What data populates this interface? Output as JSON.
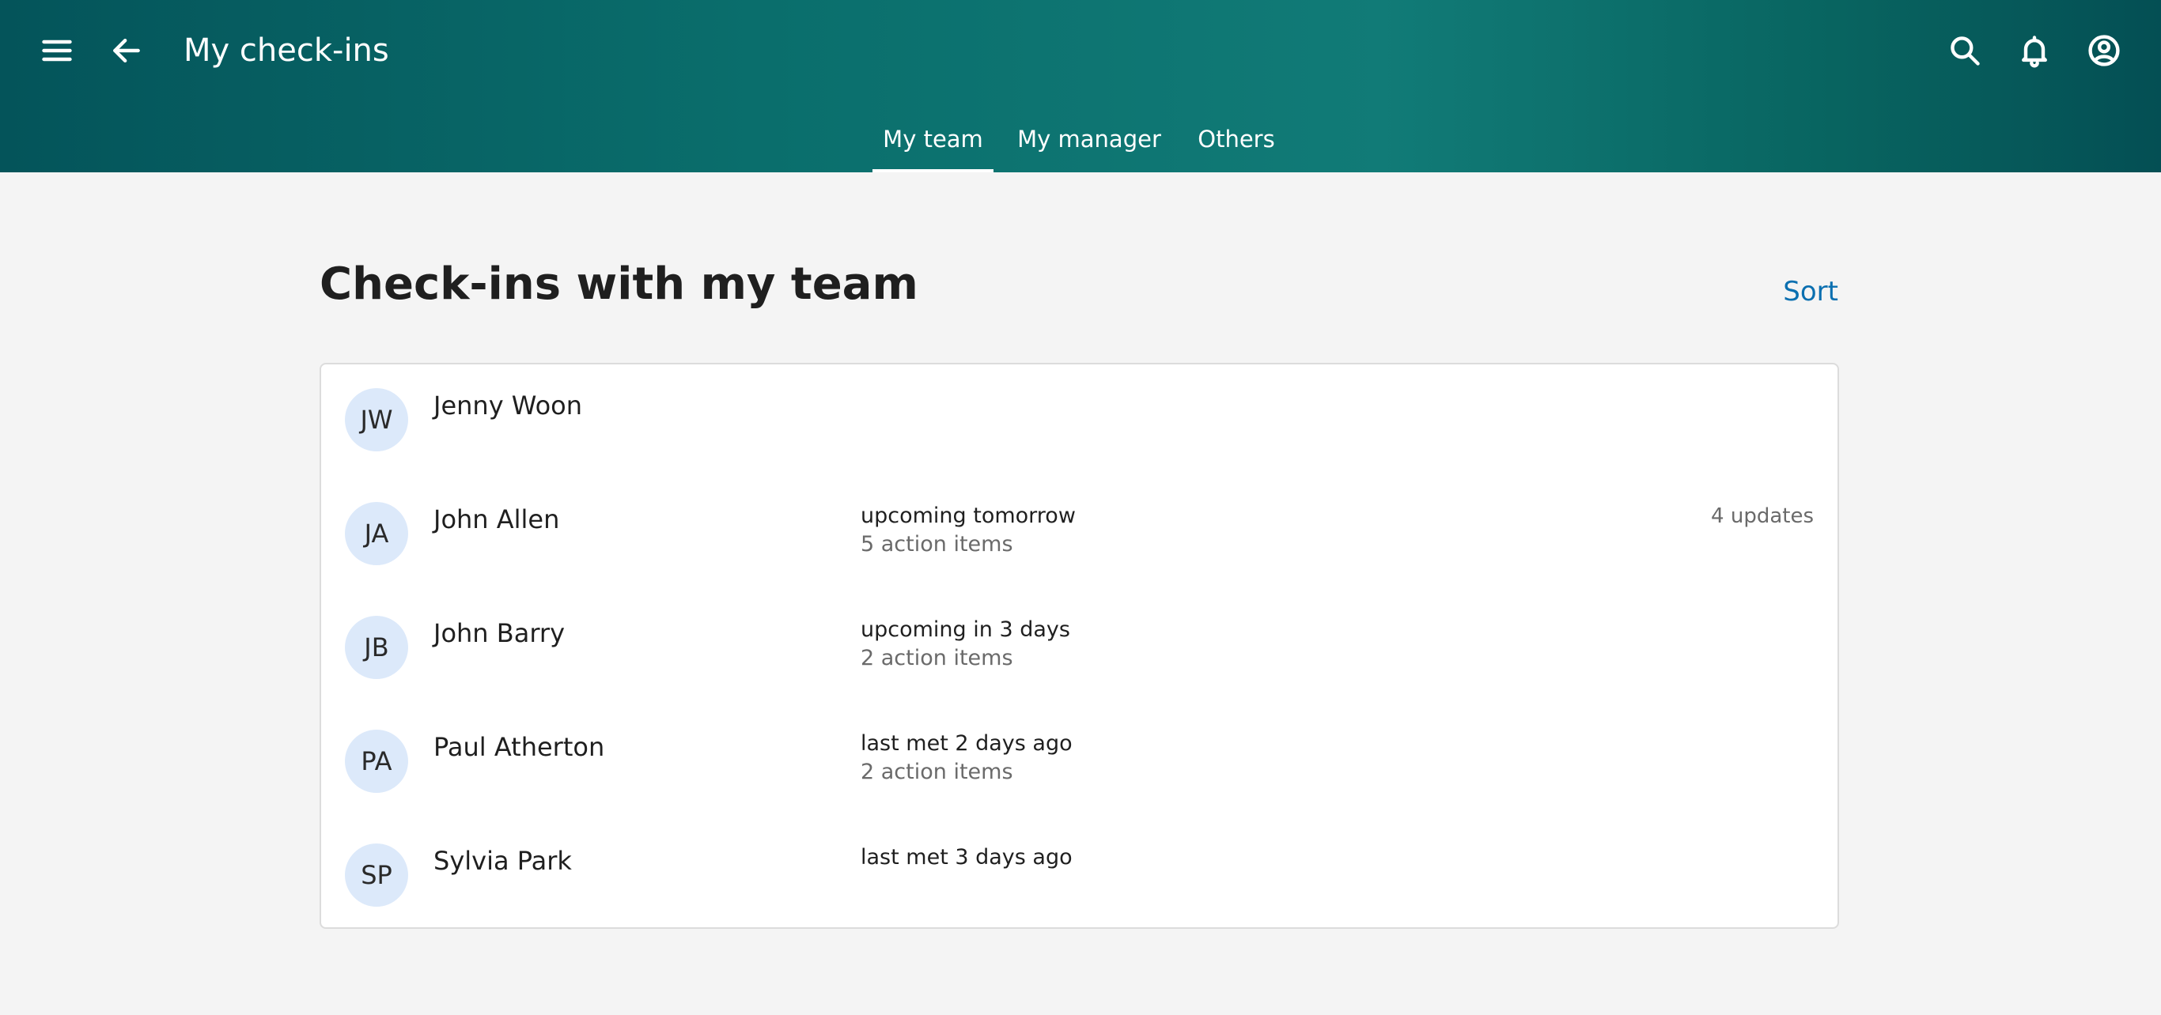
{
  "header": {
    "title": "My check-ins",
    "icons": {
      "menu": "menu-icon",
      "back": "arrow-left-icon",
      "search": "search-icon",
      "notifications": "bell-icon",
      "account": "account-circle-icon"
    },
    "tabs": [
      {
        "label": "My team",
        "active": true
      },
      {
        "label": "My manager",
        "active": false
      },
      {
        "label": "Others",
        "active": false
      }
    ]
  },
  "main": {
    "heading": "Check-ins with my team",
    "sort_label": "Sort",
    "people": [
      {
        "initials": "JW",
        "name": "Jenny Woon",
        "status": "",
        "action_items": "",
        "updates": ""
      },
      {
        "initials": "JA",
        "name": "John Allen",
        "status": "upcoming tomorrow",
        "action_items": "5 action items",
        "updates": "4 updates"
      },
      {
        "initials": "JB",
        "name": "John Barry",
        "status": "upcoming in 3 days",
        "action_items": "2 action items",
        "updates": ""
      },
      {
        "initials": "PA",
        "name": "Paul Atherton",
        "status": "last met 2 days ago",
        "action_items": "2 action items",
        "updates": ""
      },
      {
        "initials": "SP",
        "name": "Sylvia Park",
        "status": "last met 3 days ago",
        "action_items": "",
        "updates": ""
      }
    ]
  },
  "colors": {
    "header_gradient": [
      "#04545a",
      "#117b77",
      "#044f54"
    ],
    "accent_link": "#0a6fb0",
    "avatar_bg": "#dce9fa",
    "page_bg": "#f4f4f4"
  }
}
